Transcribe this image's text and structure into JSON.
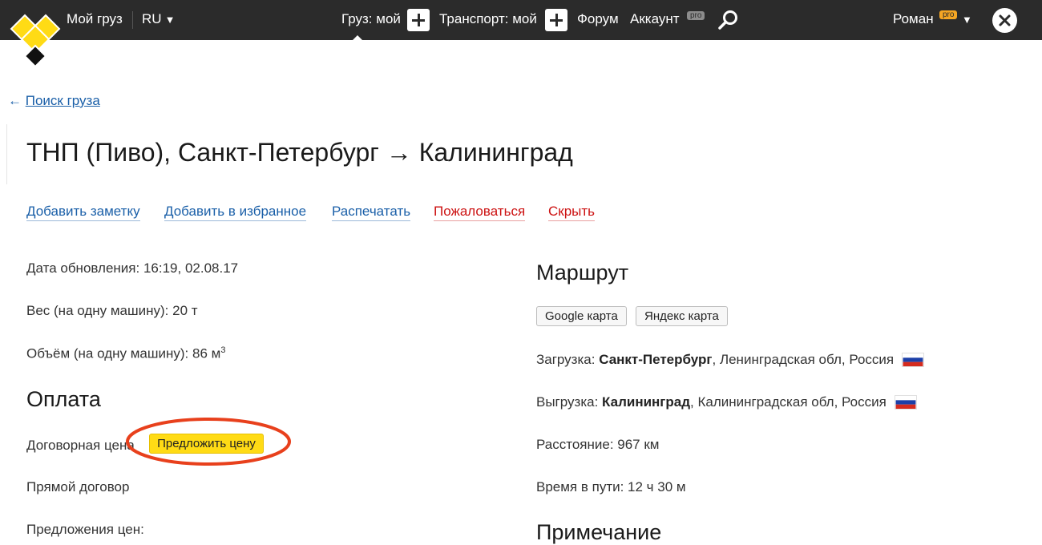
{
  "topbar": {
    "my_cargo": "Мой груз",
    "lang": "RU",
    "cargo_my": "Груз: мой",
    "transport_my": "Транспорт: мой",
    "forum": "Форум",
    "account": "Аккаунт",
    "pro_badge": "pro",
    "user_name": "Роман"
  },
  "back_link": {
    "arrow": "←",
    "label": "Поиск груза"
  },
  "page_title": "ТНП (Пиво), Санкт-Петербург → Калининград",
  "actions": {
    "add_note": "Добавить заметку",
    "add_favorite": "Добавить в избранное",
    "print": "Распечатать",
    "complain": "Пожаловаться",
    "hide": "Скрыть"
  },
  "details": {
    "updated": "Дата обновления: 16:19, 02.08.17",
    "weight": "Вес (на одну машину): 20 т",
    "volume": "Объём (на одну машину): 86 м",
    "volume_sup": "3"
  },
  "payment": {
    "title": "Оплата",
    "negotiable": "Договорная цена",
    "offer_button": "Предложить цену",
    "direct_contract": "Прямой договор",
    "price_offers": "Предложения цен:"
  },
  "route": {
    "title": "Маршрут",
    "google_map": "Google карта",
    "yandex_map": "Яндекс карта",
    "loading_label": "Загрузка: ",
    "loading_city": "Санкт-Петербург",
    "loading_region": ", Ленинградская обл, Россия",
    "unloading_label": "Выгрузка: ",
    "unloading_city": "Калининград",
    "unloading_region": ", Калининградская обл, Россия",
    "distance": "Расстояние: 967 км",
    "travel_time": "Время в пути: 12 ч 30 м"
  },
  "note": {
    "title": "Примечание"
  },
  "colors": {
    "topbar_bg": "#2b2b2b",
    "link_blue": "#1a5fa8",
    "link_red": "#cc1111",
    "button_yellow": "#ffdb15",
    "highlight_red": "#e8401c",
    "logo_yellow": "#ffdb15"
  }
}
